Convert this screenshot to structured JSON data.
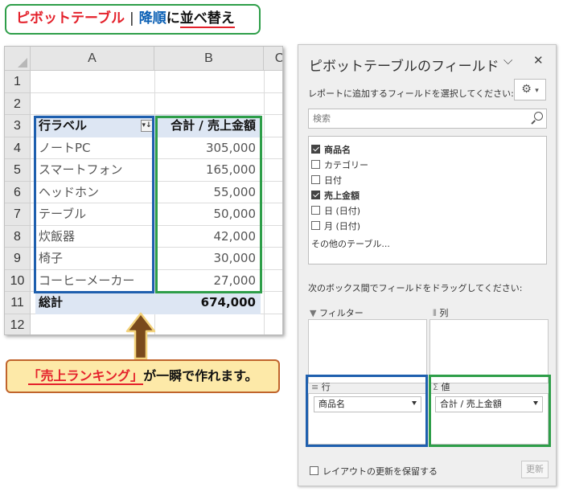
{
  "banner": {
    "part1": "ピボットテーブル",
    "separator": "|",
    "part2": "降順",
    "part3": "に",
    "part4": "並べ替え"
  },
  "sheet": {
    "columns": [
      "A",
      "B",
      "C"
    ],
    "rows": [
      "1",
      "2",
      "3",
      "4",
      "5",
      "6",
      "7",
      "8",
      "9",
      "10",
      "11",
      "12"
    ],
    "header_label": "行ラベル",
    "header_value": "合計 / 売上金額",
    "items": [
      {
        "label": "ノートPC",
        "value": "305,000"
      },
      {
        "label": "スマートフォン",
        "value": "165,000"
      },
      {
        "label": "ヘッドホン",
        "value": "55,000"
      },
      {
        "label": "テーブル",
        "value": "50,000"
      },
      {
        "label": "炊飯器",
        "value": "42,000"
      },
      {
        "label": "椅子",
        "value": "30,000"
      },
      {
        "label": "コーヒーメーカー",
        "value": "27,000"
      }
    ],
    "total_label": "総計",
    "total_value": "674,000"
  },
  "caption": {
    "highlight": "「売上ランキング」",
    "rest": "が一瞬で作れます。"
  },
  "pane": {
    "title": "ピボットテーブルのフィールド",
    "subtitle": "レポートに追加するフィールドを選択してください:",
    "search_placeholder": "検索",
    "fields": [
      {
        "label": "商品名",
        "checked": true
      },
      {
        "label": "カテゴリー",
        "checked": false
      },
      {
        "label": "日付",
        "checked": false
      },
      {
        "label": "売上金額",
        "checked": true
      },
      {
        "label": "日 (日付)",
        "checked": false
      },
      {
        "label": "月 (日付)",
        "checked": false
      }
    ],
    "more_tables": "その他のテーブル...",
    "drag_hint": "次のボックス間でフィールドをドラッグしてください:",
    "areas": {
      "filter": "フィルター",
      "columns": "列",
      "rows": "行",
      "values": "値",
      "rows_field": "商品名",
      "values_field": "合計 / 売上金額"
    },
    "defer_label": "レイアウトの更新を保留する",
    "update_label": "更新"
  },
  "colors": {
    "blue": "#1e5fae",
    "green": "#2e9e49",
    "red": "#e4212b",
    "pivot_header_bg": "#dde6f3"
  }
}
